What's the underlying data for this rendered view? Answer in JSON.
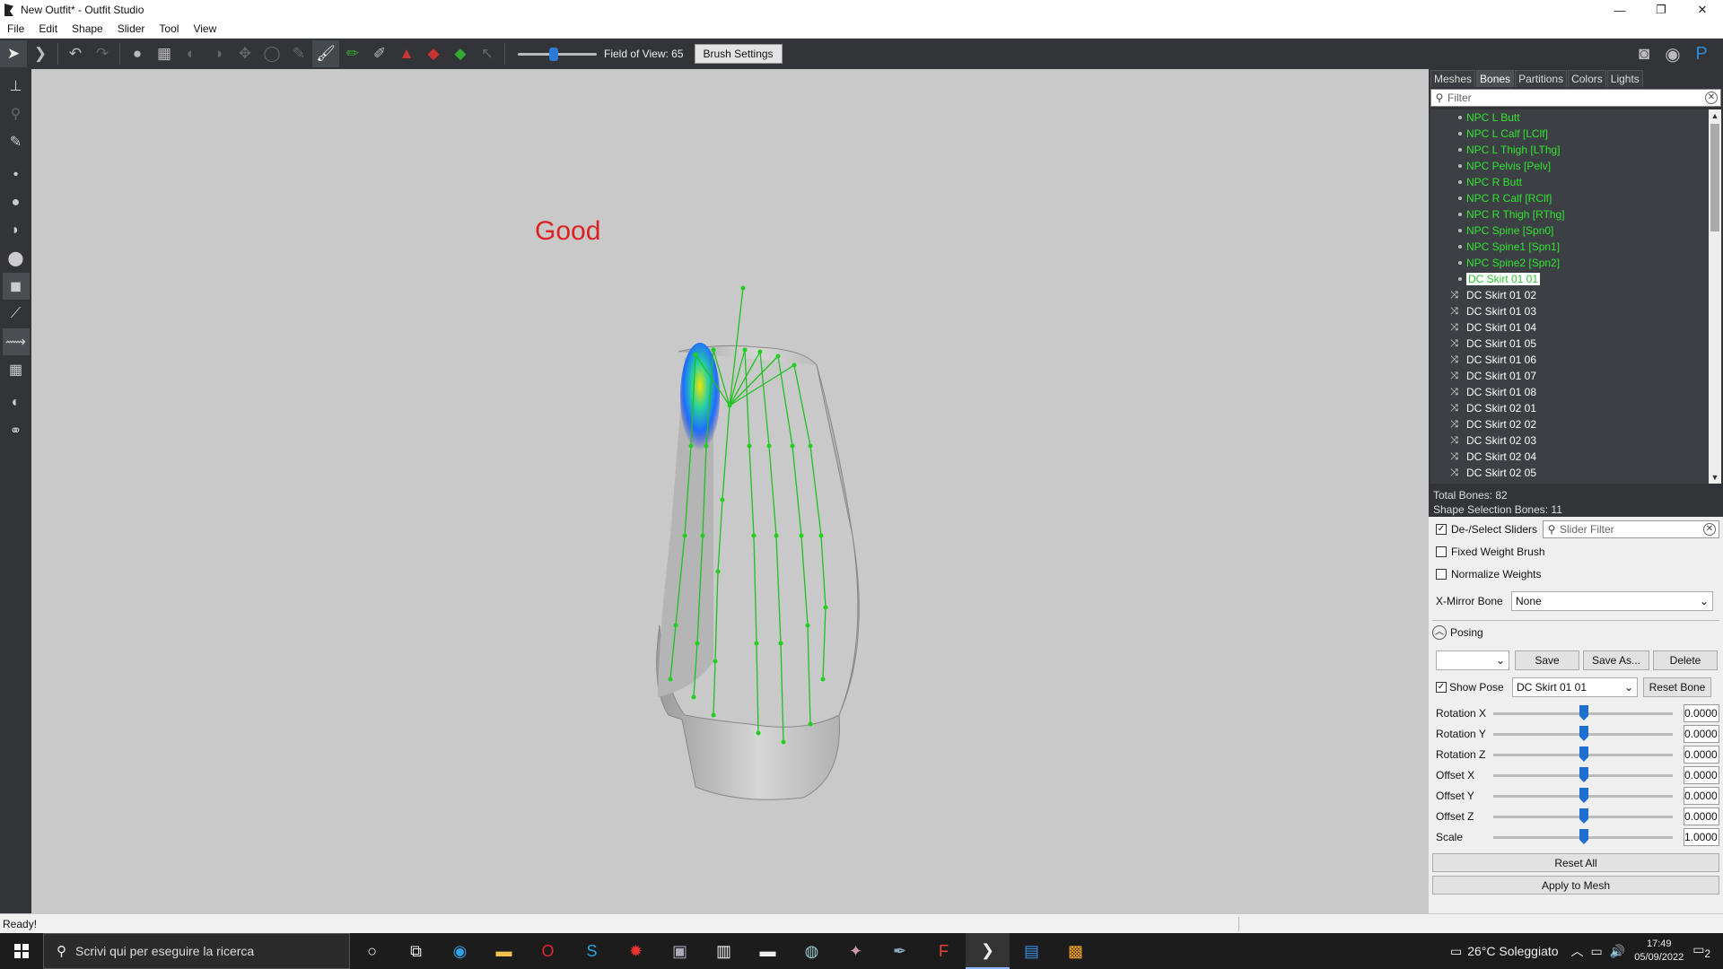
{
  "window": {
    "title": "New Outfit* - Outfit Studio",
    "controls": [
      "—",
      "❐",
      "✕"
    ]
  },
  "menu": [
    "File",
    "Edit",
    "Shape",
    "Slider",
    "Tool",
    "View"
  ],
  "toolbar": {
    "fov_label": "Field of View: 65",
    "fov_value": 0.45,
    "brush_settings": "Brush Settings"
  },
  "viewport": {
    "annotation": "Good"
  },
  "tabs": [
    "Meshes",
    "Bones",
    "Partitions",
    "Colors",
    "Lights"
  ],
  "active_tab": "Bones",
  "bone_filter": {
    "placeholder": "Filter"
  },
  "bones": [
    {
      "name": "NPC L Butt",
      "style": "green"
    },
    {
      "name": "NPC L Calf [LClf]",
      "style": "green"
    },
    {
      "name": "NPC L Thigh [LThg]",
      "style": "green"
    },
    {
      "name": "NPC Pelvis [Pelv]",
      "style": "green"
    },
    {
      "name": "NPC R Butt",
      "style": "green"
    },
    {
      "name": "NPC R Calf [RClf]",
      "style": "green"
    },
    {
      "name": "NPC R Thigh [RThg]",
      "style": "green"
    },
    {
      "name": "NPC Spine [Spn0]",
      "style": "green"
    },
    {
      "name": "NPC Spine1 [Spn1]",
      "style": "green"
    },
    {
      "name": "NPC Spine2 [Spn2]",
      "style": "green"
    },
    {
      "name": "DC Skirt 01 01",
      "style": "selected"
    },
    {
      "name": "DC Skirt 01 02",
      "style": "white"
    },
    {
      "name": "DC Skirt 01 03",
      "style": "white"
    },
    {
      "name": "DC Skirt 01 04",
      "style": "white"
    },
    {
      "name": "DC Skirt 01 05",
      "style": "white"
    },
    {
      "name": "DC Skirt 01 06",
      "style": "white"
    },
    {
      "name": "DC Skirt 01 07",
      "style": "white"
    },
    {
      "name": "DC Skirt 01 08",
      "style": "white"
    },
    {
      "name": "DC Skirt 02 01",
      "style": "white"
    },
    {
      "name": "DC Skirt 02 02",
      "style": "white"
    },
    {
      "name": "DC Skirt 02 03",
      "style": "white"
    },
    {
      "name": "DC Skirt 02 04",
      "style": "white"
    },
    {
      "name": "DC Skirt 02 05",
      "style": "white"
    }
  ],
  "bone_stats": {
    "total": "Total Bones: 82",
    "selection": "Shape Selection Bones: 11"
  },
  "options": {
    "deselect_sliders": "De-/Select Sliders",
    "slider_filter_placeholder": "Slider Filter",
    "fixed_weight_brush": "Fixed Weight Brush",
    "normalize_weights": "Normalize Weights",
    "xmirror_label": "X-Mirror Bone",
    "xmirror_value": "None"
  },
  "posing": {
    "header": "Posing",
    "pose_select": "",
    "save": "Save",
    "save_as": "Save As...",
    "delete": "Delete",
    "show_pose": "Show Pose",
    "bone_select": "DC Skirt 01 01",
    "reset_bone": "Reset Bone",
    "sliders": [
      {
        "label": "Rotation X",
        "value": "0.0000"
      },
      {
        "label": "Rotation Y",
        "value": "0.0000"
      },
      {
        "label": "Rotation Z",
        "value": "0.0000"
      },
      {
        "label": "Offset X",
        "value": "0.0000"
      },
      {
        "label": "Offset Y",
        "value": "0.0000"
      },
      {
        "label": "Offset Z",
        "value": "0.0000"
      },
      {
        "label": "Scale",
        "value": "1.0000"
      }
    ],
    "reset_all": "Reset All",
    "apply_to_mesh": "Apply to Mesh"
  },
  "status": "Ready!",
  "taskbar": {
    "search_placeholder": "Scrivi qui per eseguire la ricerca",
    "weather": "26°C Soleggiato",
    "time": "17:49",
    "date": "05/09/2022",
    "notifications": "2"
  }
}
